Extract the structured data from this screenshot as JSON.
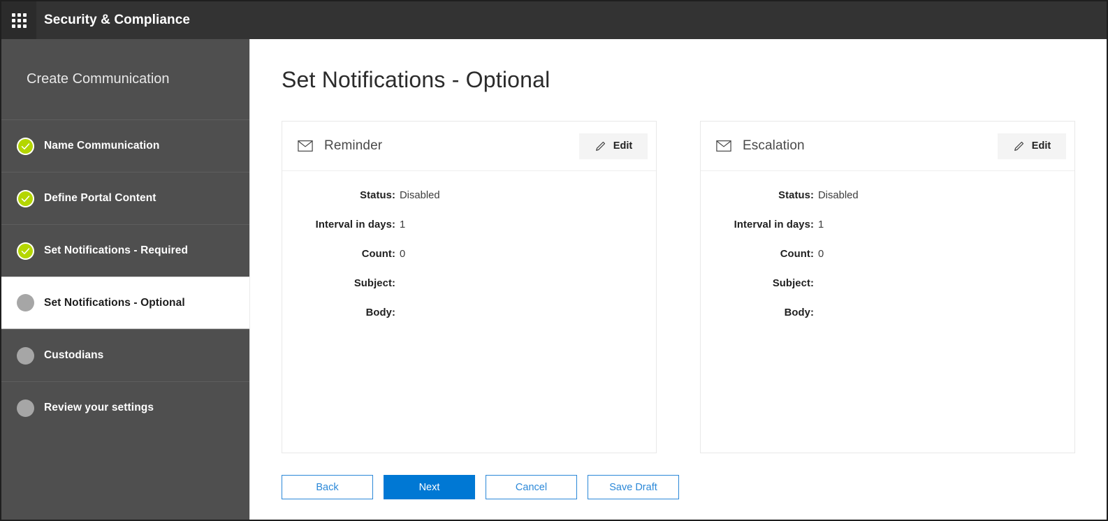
{
  "topbar": {
    "waffle_icon": "waffle-grid-icon",
    "title": "Security & Compliance"
  },
  "sidebar": {
    "heading": "Create Communication",
    "items": [
      {
        "label": "Name Communication",
        "state": "done",
        "icon": "check-circle-icon"
      },
      {
        "label": "Define Portal Content",
        "state": "done",
        "icon": "check-circle-icon"
      },
      {
        "label": "Set Notifications - Required",
        "state": "done",
        "icon": "check-circle-icon"
      },
      {
        "label": "Set Notifications - Optional",
        "state": "active",
        "icon": "dot-circle-icon"
      },
      {
        "label": "Custodians",
        "state": "pending",
        "icon": "dot-circle-icon"
      },
      {
        "label": "Review your settings",
        "state": "pending",
        "icon": "dot-circle-icon"
      }
    ]
  },
  "main": {
    "page_title": "Set Notifications - Optional",
    "cards": [
      {
        "icon": "envelope-icon",
        "title": "Reminder",
        "edit_label": "Edit",
        "edit_icon": "pencil-icon",
        "fields": [
          {
            "label": "Status:",
            "value": "Disabled"
          },
          {
            "label": "Interval in days:",
            "value": "1"
          },
          {
            "label": "Count:",
            "value": "0"
          },
          {
            "label": "Subject:",
            "value": ""
          },
          {
            "label": "Body:",
            "value": ""
          }
        ]
      },
      {
        "icon": "envelope-icon",
        "title": "Escalation",
        "edit_label": "Edit",
        "edit_icon": "pencil-icon",
        "fields": [
          {
            "label": "Status:",
            "value": "Disabled"
          },
          {
            "label": "Interval in days:",
            "value": "1"
          },
          {
            "label": "Count:",
            "value": "0"
          },
          {
            "label": "Subject:",
            "value": ""
          },
          {
            "label": "Body:",
            "value": ""
          }
        ]
      }
    ],
    "actions": [
      {
        "label": "Back",
        "style": "outline"
      },
      {
        "label": "Next",
        "style": "primary"
      },
      {
        "label": "Cancel",
        "style": "outline"
      },
      {
        "label": "Save Draft",
        "style": "outline"
      }
    ]
  },
  "colors": {
    "topbar_bg": "#333333",
    "sidebar_bg": "#4f4f4f",
    "accent_blue": "#0078d4",
    "link_blue": "#2b88d8",
    "done_green": "#b4d600",
    "pending_gray": "#a6a6a6"
  }
}
